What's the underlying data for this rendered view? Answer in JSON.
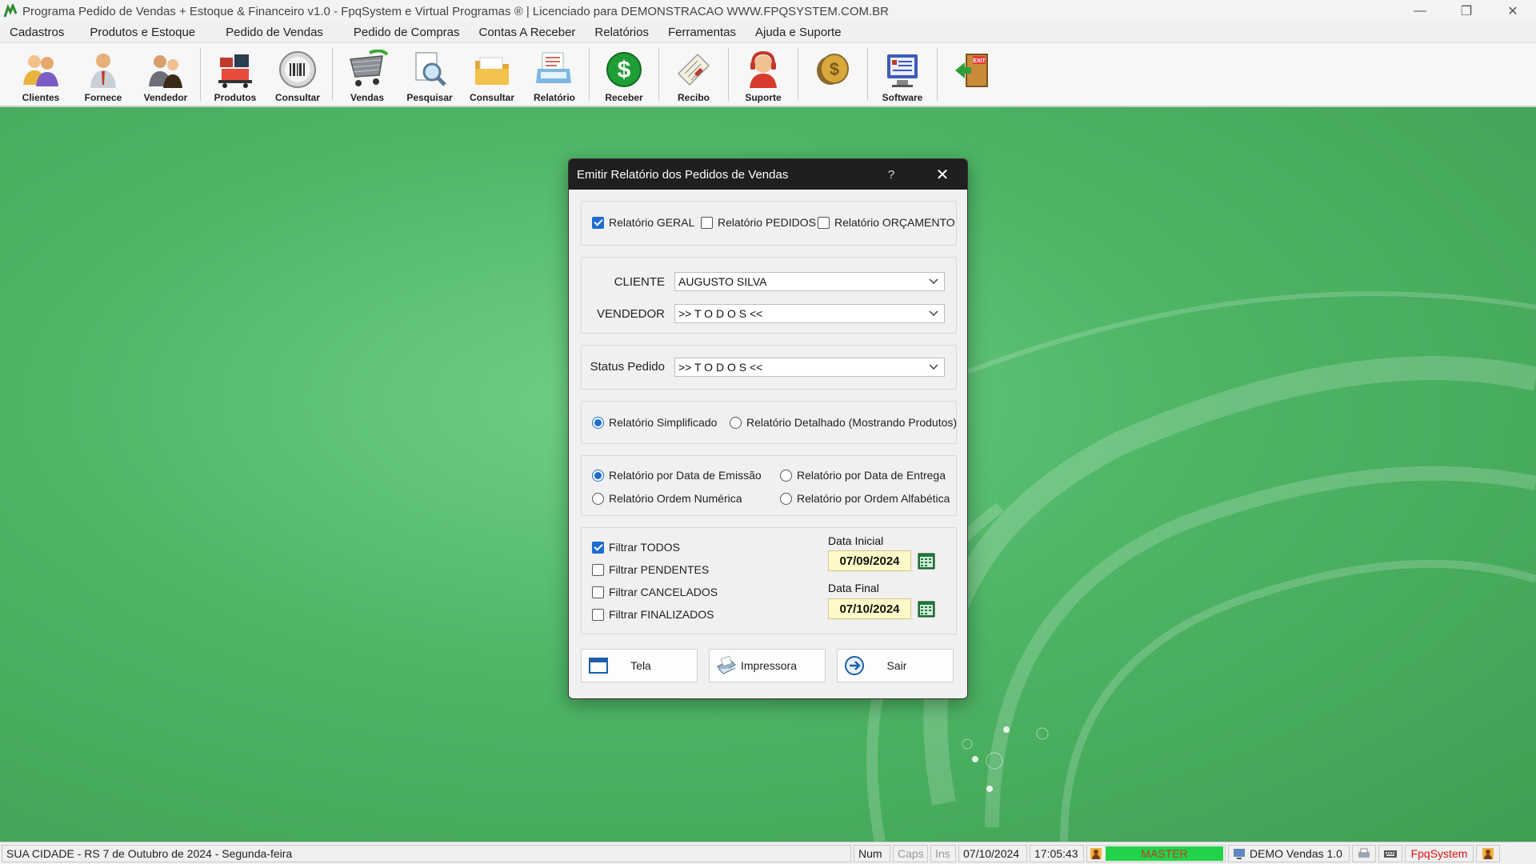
{
  "window": {
    "title": "Programa Pedido de Vendas + Estoque & Financeiro v1.0 - FpqSystem e Virtual Programas ® | Licenciado para  DEMONSTRACAO WWW.FPQSYSTEM.COM.BR"
  },
  "menu": [
    "Cadastros",
    "Produtos e Estoque",
    "Pedido de Vendas",
    "Pedido de Compras",
    "Contas A Receber",
    "Relatórios",
    "Ferramentas",
    "Ajuda e Suporte"
  ],
  "toolbar": [
    {
      "label": "Clientes",
      "icon": "clients-icon"
    },
    {
      "label": "Fornece",
      "icon": "supplier-icon"
    },
    {
      "label": "Vendedor",
      "icon": "seller-icon"
    },
    {
      "label": "Produtos",
      "icon": "products-icon"
    },
    {
      "label": "Consultar",
      "icon": "barcode-icon"
    },
    {
      "label": "Vendas",
      "icon": "cart-icon"
    },
    {
      "label": "Pesquisar",
      "icon": "search-document-icon"
    },
    {
      "label": "Consultar",
      "icon": "folder-icon"
    },
    {
      "label": "Relatório",
      "icon": "report-icon"
    },
    {
      "label": "Receber",
      "icon": "dollar-icon"
    },
    {
      "label": "Recibo",
      "icon": "receipt-icon"
    },
    {
      "label": "Suporte",
      "icon": "support-icon"
    },
    {
      "label": "",
      "icon": "coins-icon"
    },
    {
      "label": "Software",
      "icon": "software-icon"
    },
    {
      "label": "",
      "icon": "exit-icon"
    }
  ],
  "dialog": {
    "title": "Emitir Relatório dos Pedidos de Vendas",
    "help": "?",
    "report_types": [
      {
        "label": "Relatório GERAL",
        "checked": true
      },
      {
        "label": "Relatório PEDIDOS",
        "checked": false
      },
      {
        "label": "Relatório ORÇAMENTO",
        "checked": false
      }
    ],
    "cliente_label": "CLIENTE",
    "cliente_value": "AUGUSTO SILVA",
    "vendedor_label": "VENDEDOR",
    "vendedor_value": ">> T O D O S <<",
    "status_label": "Status Pedido",
    "status_value": ">> T O D O S <<",
    "detail": [
      {
        "label": "Relatório Simplificado",
        "selected": true
      },
      {
        "label": "Relatório Detalhado (Mostrando Produtos)",
        "selected": false
      }
    ],
    "order": [
      {
        "label": "Relatório por Data de Emissão",
        "selected": true
      },
      {
        "label": "Relatório por Data de Entrega",
        "selected": false
      },
      {
        "label": "Relatório Ordem Numérica",
        "selected": false
      },
      {
        "label": "Relatório por Ordem Alfabética",
        "selected": false
      }
    ],
    "filters": [
      {
        "label": "Filtrar TODOS",
        "checked": true
      },
      {
        "label": "Filtrar PENDENTES",
        "checked": false
      },
      {
        "label": "Filtrar CANCELADOS",
        "checked": false
      },
      {
        "label": "Filtrar FINALIZADOS",
        "checked": false
      }
    ],
    "data_inicial_label": "Data Inicial",
    "data_inicial": "07/09/2024",
    "data_final_label": "Data Final",
    "data_final": "07/10/2024",
    "buttons": {
      "tela": "Tela",
      "impressora": "Impressora",
      "sair": "Sair"
    }
  },
  "status": {
    "location": "SUA CIDADE - RS  7 de Outubro de 2024 - Segunda-feira",
    "num": "Num",
    "caps": "Caps",
    "ins": "Ins",
    "date": "07/10/2024",
    "time": "17:05:43",
    "user": "MASTER",
    "version": "DEMO Vendas 1.0",
    "brand": "FpqSystem"
  },
  "colors": {
    "desktop": "#4eb565",
    "accent": "#1d6cd0",
    "date_bg": "#fff9c8",
    "user_bg": "#22d34a",
    "brand": "#d11"
  }
}
